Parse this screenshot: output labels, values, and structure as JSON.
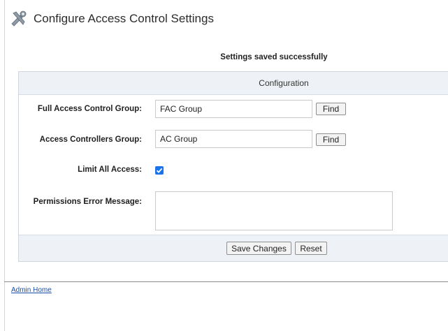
{
  "header": {
    "title": "Configure Access Control Settings",
    "icon": "tools-icon"
  },
  "status": {
    "message": "Settings saved successfully"
  },
  "panel": {
    "title": "Configuration",
    "fields": {
      "full_access": {
        "label": "Full Access Control Group:",
        "value": "FAC Group",
        "button": "Find"
      },
      "controllers": {
        "label": "Access Controllers Group:",
        "value": "AC Group",
        "button": "Find"
      },
      "limit_all": {
        "label": "Limit All Access:",
        "checked": true
      },
      "error_message": {
        "label": "Permissions Error Message:",
        "value": ""
      }
    },
    "actions": {
      "save": "Save Changes",
      "reset": "Reset"
    }
  },
  "footer": {
    "link": "Admin Home"
  },
  "colors": {
    "accent": "#1a73e8",
    "panel_bg": "#eef1f5",
    "link": "#1a4ea8"
  }
}
